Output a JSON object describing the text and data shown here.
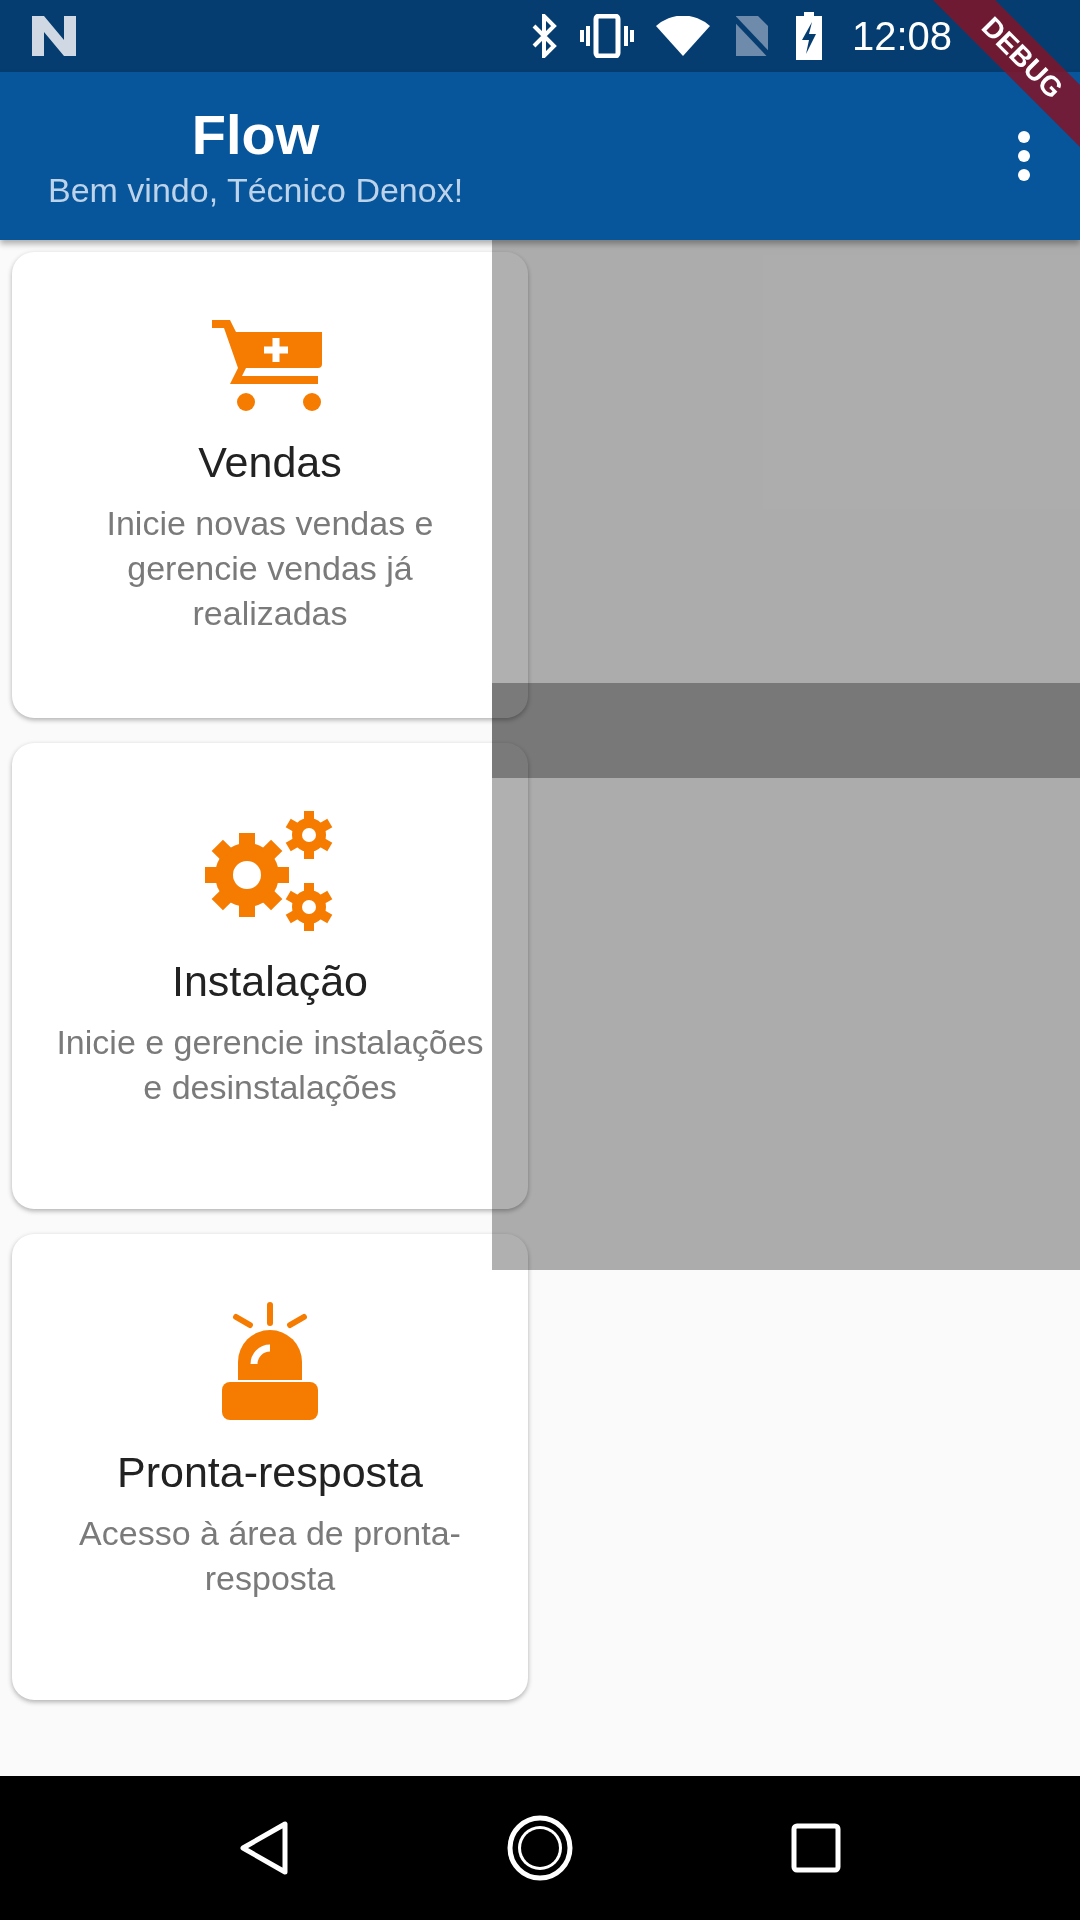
{
  "status_bar": {
    "time": "12:08"
  },
  "app_bar": {
    "title": "Flow",
    "subtitle": "Bem vindo, Técnico Denox!"
  },
  "debug_banner": "DEBUG",
  "cards": [
    {
      "kind": "cart",
      "title": "Vendas",
      "description": "Inicie novas vendas e gerencie vendas já realizadas"
    },
    {
      "kind": "gears",
      "title": "Instalação",
      "description": "Inicie e gerencie instalações e desinstalações"
    },
    {
      "kind": "siren",
      "title": "Pronta-resposta",
      "description": "Acesso à área de pronta-resposta"
    }
  ]
}
